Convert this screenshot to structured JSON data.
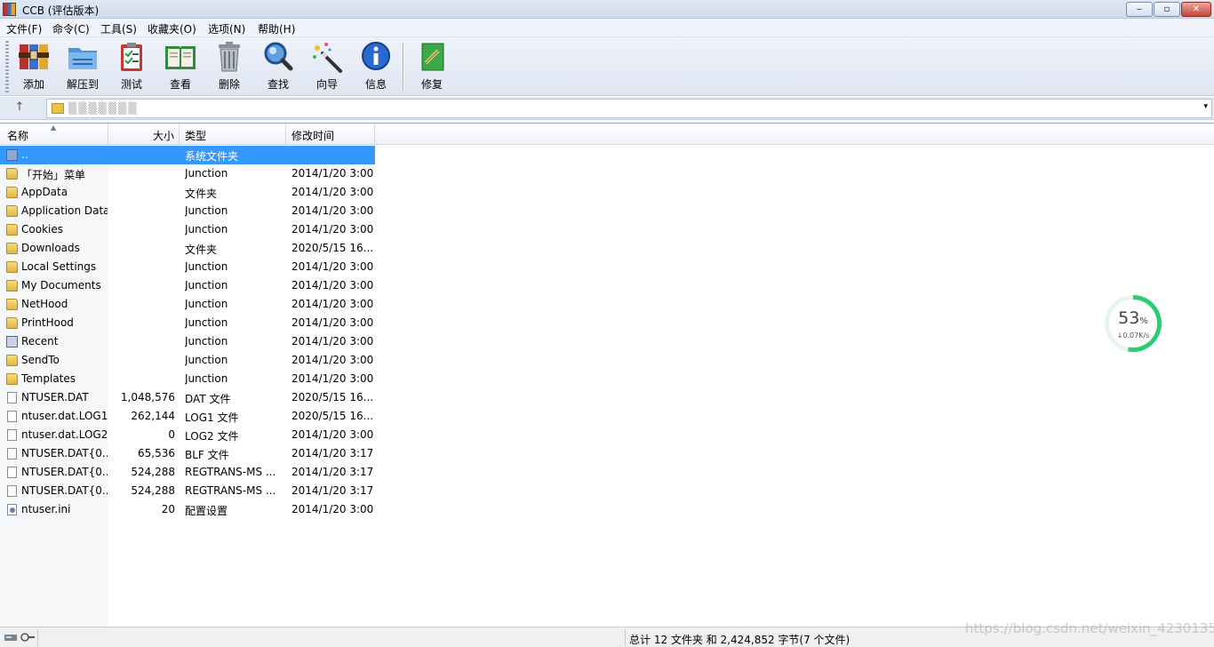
{
  "window": {
    "title": "CCB (评估版本)",
    "min_label": "‒",
    "max_label": "▫",
    "close_label": "✕"
  },
  "menu": [
    "文件(F)",
    "命令(C)",
    "工具(S)",
    "收藏夹(O)",
    "选项(N)",
    "帮助(H)"
  ],
  "toolbar": {
    "add": "添加",
    "extract": "解压到",
    "test": "测试",
    "view": "查看",
    "delete": "删除",
    "find": "查找",
    "wizard": "向导",
    "info": "信息",
    "repair": "修复"
  },
  "address": {
    "path": "▒▒▒▒▒▒▒",
    "dropdown_glyph": "▾",
    "up_glyph": "↑"
  },
  "columns": {
    "name": "名称",
    "size": "大小",
    "type": "类型",
    "modified": "修改时间"
  },
  "files": [
    {
      "name": "..",
      "size": "",
      "type": "系统文件夹",
      "modified": "",
      "icon": "up"
    },
    {
      "name": "「开始」菜单",
      "size": "",
      "type": "Junction",
      "modified": "2014/1/20 3:00",
      "icon": "folder"
    },
    {
      "name": "AppData",
      "size": "",
      "type": "文件夹",
      "modified": "2014/1/20 3:00",
      "icon": "folder"
    },
    {
      "name": "Application Data",
      "size": "",
      "type": "Junction",
      "modified": "2014/1/20 3:00",
      "icon": "folder"
    },
    {
      "name": "Cookies",
      "size": "",
      "type": "Junction",
      "modified": "2014/1/20 3:00",
      "icon": "folder"
    },
    {
      "name": "Downloads",
      "size": "",
      "type": "文件夹",
      "modified": "2020/5/15 16...",
      "icon": "folder"
    },
    {
      "name": "Local Settings",
      "size": "",
      "type": "Junction",
      "modified": "2014/1/20 3:00",
      "icon": "folder"
    },
    {
      "name": "My Documents",
      "size": "",
      "type": "Junction",
      "modified": "2014/1/20 3:00",
      "icon": "folder"
    },
    {
      "name": "NetHood",
      "size": "",
      "type": "Junction",
      "modified": "2014/1/20 3:00",
      "icon": "folder"
    },
    {
      "name": "PrintHood",
      "size": "",
      "type": "Junction",
      "modified": "2014/1/20 3:00",
      "icon": "folder"
    },
    {
      "name": "Recent",
      "size": "",
      "type": "Junction",
      "modified": "2014/1/20 3:00",
      "icon": "recent"
    },
    {
      "name": "SendTo",
      "size": "",
      "type": "Junction",
      "modified": "2014/1/20 3:00",
      "icon": "folder"
    },
    {
      "name": "Templates",
      "size": "",
      "type": "Junction",
      "modified": "2014/1/20 3:00",
      "icon": "folder"
    },
    {
      "name": "NTUSER.DAT",
      "size": "1,048,576",
      "type": "DAT 文件",
      "modified": "2020/5/15 16...",
      "icon": "doc"
    },
    {
      "name": "ntuser.dat.LOG1",
      "size": "262,144",
      "type": "LOG1 文件",
      "modified": "2020/5/15 16...",
      "icon": "doc"
    },
    {
      "name": "ntuser.dat.LOG2",
      "size": "0",
      "type": "LOG2 文件",
      "modified": "2014/1/20 3:00",
      "icon": "doc"
    },
    {
      "name": "NTUSER.DAT{0...",
      "size": "65,536",
      "type": "BLF 文件",
      "modified": "2014/1/20 3:17",
      "icon": "doc"
    },
    {
      "name": "NTUSER.DAT{0...",
      "size": "524,288",
      "type": "REGTRANS-MS ...",
      "modified": "2014/1/20 3:17",
      "icon": "doc"
    },
    {
      "name": "NTUSER.DAT{0...",
      "size": "524,288",
      "type": "REGTRANS-MS ...",
      "modified": "2014/1/20 3:17",
      "icon": "doc"
    },
    {
      "name": "ntuser.ini",
      "size": "20",
      "type": "配置设置",
      "modified": "2014/1/20 3:00",
      "icon": "ini"
    }
  ],
  "speed_widget": {
    "percent": "53",
    "percent_sign": "%",
    "rate": "↓0.07K/s",
    "percent_value": 53
  },
  "status": {
    "summary": "总计 12 文件夹 和 2,424,852 字节(7 个文件)"
  },
  "watermark": "https://blog.csdn.net/weixin_4230135",
  "colors": {
    "selection": "#3399ff",
    "speed_ring": "#2ecc71"
  }
}
